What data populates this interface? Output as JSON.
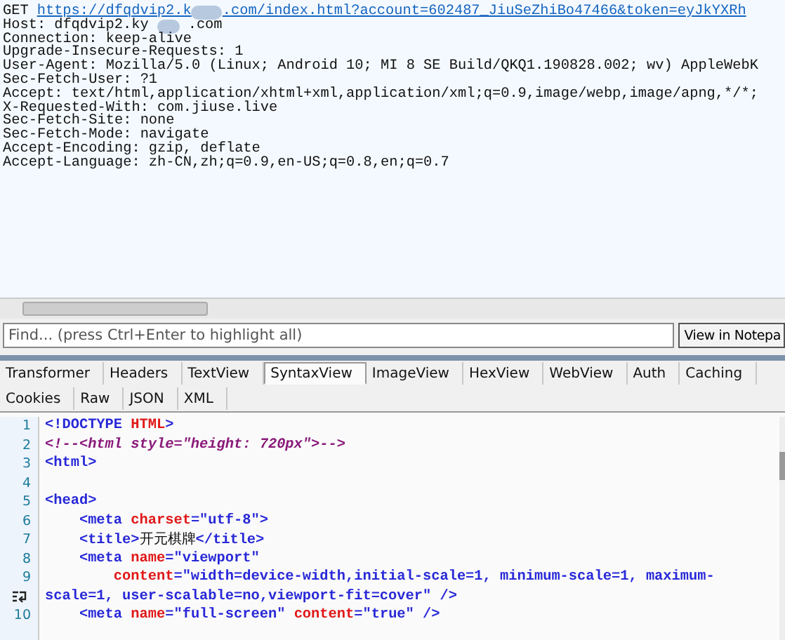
{
  "request": {
    "method": "GET",
    "url_parts": [
      "https://dfqdvip2.k",
      ".com/index.html?account=602487_JiuSeZhiBo47466&token=eyJkYXRh"
    ],
    "host_label": "Host:",
    "host_parts": [
      "dfqdvip2.ky",
      ".com"
    ],
    "headers": [
      "Connection: keep-alive",
      "Upgrade-Insecure-Requests: 1",
      "User-Agent: Mozilla/5.0 (Linux; Android 10; MI 8 SE Build/QKQ1.190828.002; wv) AppleWebK",
      "Sec-Fetch-User: ?1",
      "Accept: text/html,application/xhtml+xml,application/xml;q=0.9,image/webp,image/apng,*/*;",
      "X-Requested-With: com.jiuse.live",
      "Sec-Fetch-Site: none",
      "Sec-Fetch-Mode: navigate",
      "Accept-Encoding: gzip, deflate",
      "Accept-Language: zh-CN,zh;q=0.9,en-US;q=0.8,en;q=0.7"
    ]
  },
  "find": {
    "placeholder": "Find... (press Ctrl+Enter to highlight all)",
    "button": "View in Notepa"
  },
  "tabs_row_1": [
    {
      "label": "Transformer",
      "selected": false
    },
    {
      "label": "Headers",
      "selected": false
    },
    {
      "label": "TextView",
      "selected": false
    },
    {
      "label": "SyntaxView",
      "selected": true
    },
    {
      "label": "ImageView",
      "selected": false
    },
    {
      "label": "HexView",
      "selected": false
    },
    {
      "label": "WebView",
      "selected": false
    },
    {
      "label": "Auth",
      "selected": false
    },
    {
      "label": "Caching",
      "selected": false
    }
  ],
  "tabs_row_2": [
    {
      "label": "Cookies",
      "selected": false
    },
    {
      "label": "Raw",
      "selected": false
    },
    {
      "label": "JSON",
      "selected": false
    },
    {
      "label": "XML",
      "selected": false
    }
  ],
  "code": [
    {
      "number": "1",
      "tokens": [
        {
          "kind": "tag",
          "text": "<!DOCTYPE "
        },
        {
          "kind": "attr",
          "text": "HTML"
        },
        {
          "kind": "tag",
          "text": ">"
        }
      ]
    },
    {
      "number": "2",
      "tokens": [
        {
          "kind": "comment",
          "text": "<!--<html style=\"height: 720px\">-->"
        }
      ]
    },
    {
      "number": "3",
      "tokens": [
        {
          "kind": "tag",
          "text": "<html>"
        }
      ]
    },
    {
      "number": "4"
    },
    {
      "number": "5",
      "tokens": [
        {
          "kind": "tag",
          "text": "<head>"
        }
      ]
    },
    {
      "number": "6",
      "tokens": [
        {
          "kind": "tag",
          "text": "    <meta "
        },
        {
          "kind": "attr",
          "text": "charset"
        },
        {
          "kind": "tag",
          "text": "=\"utf-8\">"
        }
      ]
    },
    {
      "number": "7",
      "tokens": [
        {
          "kind": "tag",
          "text": "    <title>"
        },
        {
          "kind": "text",
          "text": "开元棋牌"
        },
        {
          "kind": "tag",
          "text": "</title>"
        }
      ]
    },
    {
      "number": "8",
      "tokens": [
        {
          "kind": "tag",
          "text": "    <meta "
        },
        {
          "kind": "attr",
          "text": "name"
        },
        {
          "kind": "tag",
          "text": "=\"viewport\""
        }
      ]
    },
    {
      "number": "9",
      "tokens": [
        {
          "kind": "attr",
          "text": "        content"
        },
        {
          "kind": "tag",
          "text": "=\"width=device-width,initial-scale=1, minimum-scale=1, maximum-"
        }
      ]
    },
    {
      "wrapped": true,
      "tokens": [
        {
          "kind": "tag",
          "text": "scale=1, user-scalable=no,viewport-fit=cover\" />"
        }
      ]
    },
    {
      "number": "10",
      "tokens": [
        {
          "kind": "tag",
          "text": "    <meta "
        },
        {
          "kind": "attr",
          "text": "name"
        },
        {
          "kind": "tag",
          "text": "=\"full-screen\" "
        },
        {
          "kind": "attr",
          "text": "content"
        },
        {
          "kind": "tag",
          "text": "=\"true\" />"
        }
      ]
    }
  ]
}
